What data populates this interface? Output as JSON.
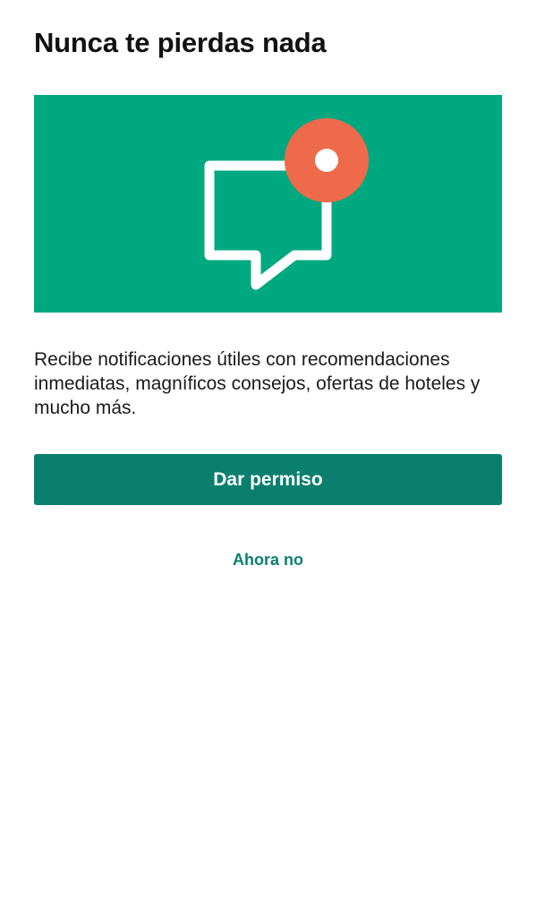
{
  "header": {
    "title": "Nunca te pierdas nada"
  },
  "hero": {
    "background_color": "#00a880",
    "icon": "chat-bubble-notification-icon",
    "badge_color": "#ef6a4a"
  },
  "body": {
    "description": "Recibe notificaciones útiles con recomendaciones inmediatas, magníficos consejos, ofertas de hoteles y mucho más."
  },
  "actions": {
    "primary_label": "Dar permiso",
    "primary_color": "#0a7f6e",
    "secondary_label": "Ahora no",
    "secondary_color": "#0a7f6e"
  }
}
